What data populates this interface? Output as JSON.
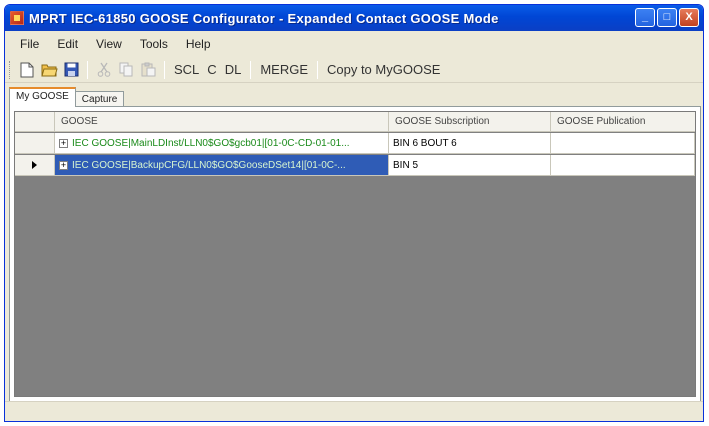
{
  "window": {
    "title": "MPRT   IEC-61850 GOOSE Configurator - Expanded Contact GOOSE Mode",
    "minimize_glyph": "_",
    "maximize_glyph": "□",
    "close_glyph": "X"
  },
  "menu": {
    "items": [
      "File",
      "Edit",
      "View",
      "Tools",
      "Help"
    ]
  },
  "toolbar": {
    "icons": [
      "new-document-icon",
      "open-folder-icon",
      "save-icon",
      "cut-icon",
      "copy-icon",
      "paste-icon"
    ],
    "scl_label": "SCL",
    "c_label": "C",
    "dl_label": "DL",
    "merge_label": "MERGE",
    "copy_label": "Copy to MyGOOSE"
  },
  "tabs": {
    "items": [
      {
        "label": "My GOOSE",
        "active": true
      },
      {
        "label": "Capture",
        "active": false
      }
    ]
  },
  "grid": {
    "columns": [
      "GOOSE",
      "GOOSE Subscription",
      "GOOSE Publication"
    ],
    "rows": [
      {
        "goose": "IEC GOOSE|MainLDInst/LLN0$GO$gcb01|[01-0C-CD-01-01...",
        "subscription": "BIN 6 BOUT 6",
        "publication": "",
        "selected": false,
        "current": false
      },
      {
        "goose": "IEC GOOSE|BackupCFG/LLN0$GO$GooseDSet14|[01-0C-...",
        "subscription": "BIN 5",
        "publication": "",
        "selected": true,
        "current": true
      }
    ]
  },
  "colors": {
    "title_bar": "#0046d5",
    "goose_text": "#1a8a1a",
    "selection": "#2f5cb6",
    "grid_background": "#808080"
  }
}
